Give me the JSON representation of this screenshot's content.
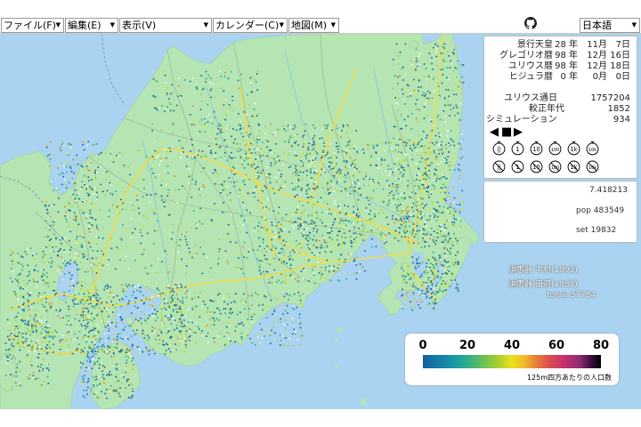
{
  "menubar": {
    "items": [
      {
        "label": "ファイル(F)"
      },
      {
        "label": "編集(E)"
      },
      {
        "label": "表示(V)"
      },
      {
        "label": "カレンダー(C)"
      },
      {
        "label": "地図(M)"
      }
    ],
    "language": "日本語"
  },
  "dates": [
    {
      "label": "景行天皇",
      "year": "28 年",
      "month": "11月",
      "day": "7日"
    },
    {
      "label": "グレゴリオ暦",
      "year": "98 年",
      "month": "12月",
      "day": "16日"
    },
    {
      "label": "ユリウス暦",
      "year": "98 年",
      "month": "12月",
      "day": "18日"
    },
    {
      "label": "ヒジュラ暦",
      "year": "0 年",
      "month": "0月",
      "day": "0日"
    }
  ],
  "counters": [
    {
      "label": "ユリウス通日",
      "value": "1757204"
    },
    {
      "label": "較正年代",
      "value": "1852"
    },
    {
      "label": "シミュレーション",
      "value": "934"
    }
  ],
  "controls": {
    "prev": "◀",
    "stop": "■",
    "next": "▶"
  },
  "speed_buttons_row1": [
    "||",
    "1",
    "10",
    "100",
    "1k",
    "10k"
  ],
  "speed_buttons_row2": [
    "||",
    "1",
    "10",
    "100",
    "1k",
    "10k"
  ],
  "info": {
    "value": "7.418213",
    "pop": "pop 483549",
    "set": "set 19832"
  },
  "map_labels": {
    "line1": "須恵器 中村(1993)",
    "line2": "須恵器 田辺(1983)",
    "line3": "torai: 57784"
  },
  "legend": {
    "ticks": [
      "0",
      "20",
      "40",
      "60",
      "80"
    ],
    "title": "125m四方あたりの人口数",
    "range": [
      0,
      80
    ]
  },
  "colors": {
    "sea": "#a9d3f0",
    "land": "#b4e5b2",
    "rivers": "#8ac0e8",
    "roads": "#f5d94a",
    "pref_borders": "#9aaa9a"
  }
}
